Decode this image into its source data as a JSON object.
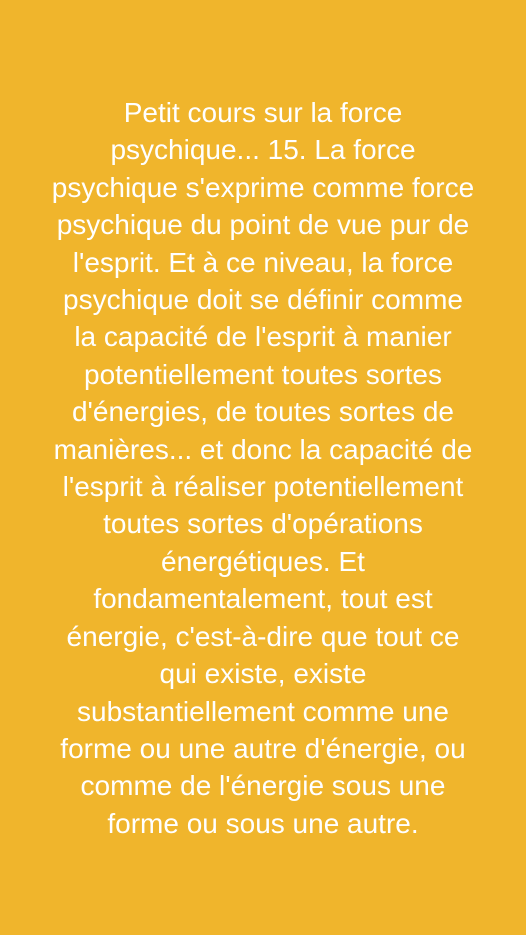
{
  "post": {
    "background_color": "#F0B52C",
    "text_color": "#FFFFFF",
    "text": "Petit cours sur la force\npsychique... 15. La force\npsychique s'exprime comme force\npsychique du point de vue pur de\nl'esprit. Et à ce niveau, la force\npsychique doit se définir comme\nla capacité de l'esprit à manier\npotentiellement toutes sortes\nd'énergies, de toutes sortes de\nmanières... et donc la capacité de\nl'esprit à réaliser potentiellement\ntoutes sortes d'opérations\nénergétiques. Et\nfondamentalement, tout est\nénergie, c'est-à-dire que tout ce\nqui existe, existe\nsubstantiellement comme une\nforme ou une autre d'énergie, ou\ncomme de l'énergie sous une\nforme ou sous une autre."
  }
}
